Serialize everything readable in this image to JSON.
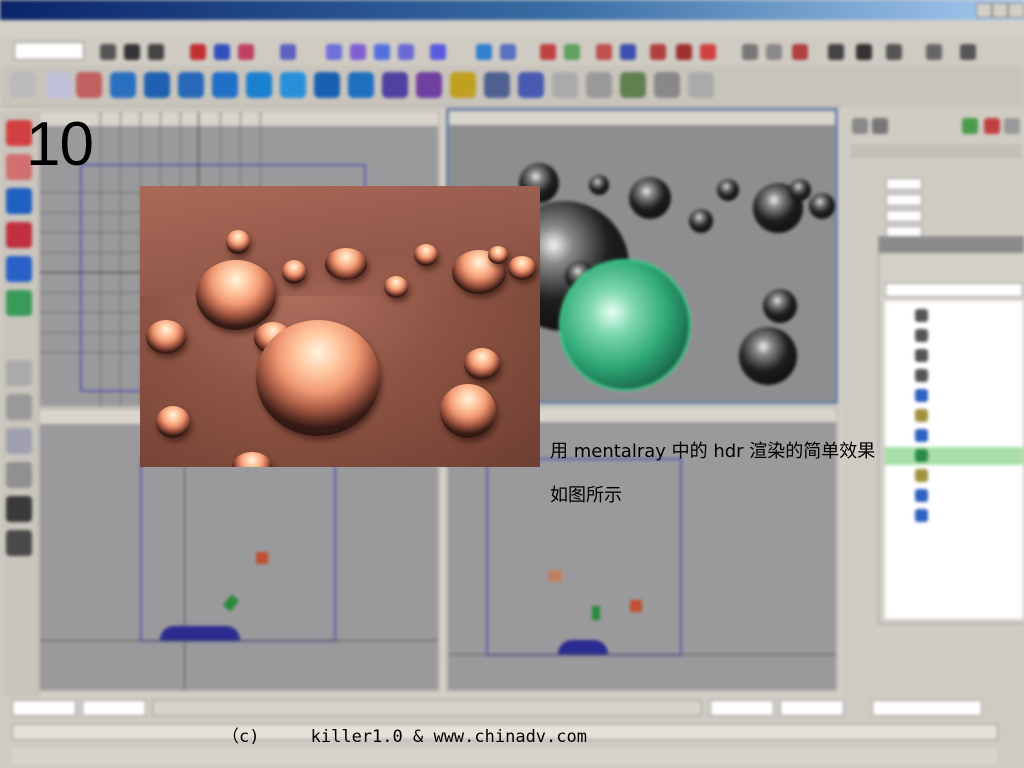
{
  "slide": {
    "step_number": "10",
    "caption_line1": "用 mentalray 中的 hdr 渲染的简单效果",
    "caption_line2": "如图所示",
    "credit": "（c)     killer1.0 & www.chinadv.com"
  },
  "background_app": {
    "icons": {
      "select": "arrow-select-icon",
      "lasso": "lasso-icon",
      "move": "move-tool-icon",
      "rotate": "rotate-tool-icon",
      "scale": "scale-tool-icon",
      "sphere": "sphere-icon",
      "cube": "cube-icon",
      "cylinder": "cylinder-icon",
      "cone": "cone-icon",
      "plane": "plane-icon",
      "light": "light-icon",
      "camera": "camera-icon"
    },
    "colors": {
      "title_gradient_start": "#0a246a",
      "title_gradient_end": "#a6caf0",
      "selected_sphere": "#2fb07a",
      "viewport_bg": "#9a9a9c",
      "render_floor": "#8e5443"
    }
  }
}
